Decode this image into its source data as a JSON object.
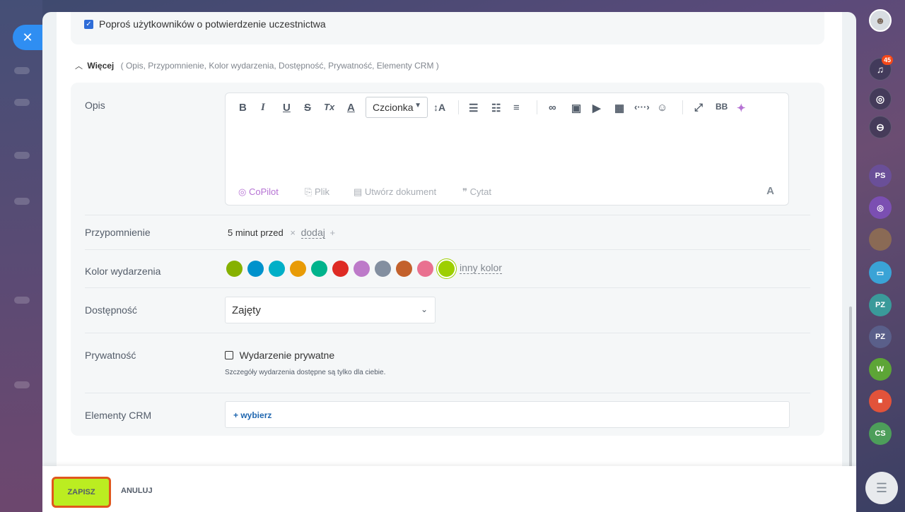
{
  "top": {
    "confirm_label": "Poproś użytkowników o potwierdzenie uczestnictwa"
  },
  "more": {
    "title": "Więcej",
    "items": "( Opis,  Przypomnienie,  Kolor wydarzenia,  Dostępność,  Prywatność,  Elementy CRM )"
  },
  "description": {
    "label": "Opis",
    "toolbar": {
      "bold": "B",
      "italic": "I",
      "underline": "U",
      "strike": "S",
      "clear": "Tx",
      "font_color": "A",
      "font_select": "Czcionka",
      "font_size": "↕A",
      "bb_code": "BB"
    },
    "footer": {
      "copilot": "CoPilot",
      "file": "Plik",
      "create_doc": "Utwórz dokument",
      "quote": "Cytat",
      "format": "A"
    }
  },
  "reminder": {
    "label": "Przypomnienie",
    "value": "5 minut przed",
    "remove": "×",
    "add": "dodaj",
    "add_plus": "+"
  },
  "color": {
    "label": "Kolor wydarzenia",
    "swatches": [
      "#86b100",
      "#0092cc",
      "#00afc7",
      "#e89b06",
      "#00b38c",
      "#de2b24",
      "#bd7ac9",
      "#838fa0",
      "#c3612c",
      "#e97090",
      "#9dcf00"
    ],
    "selected_index": 10,
    "other": "inny kolor"
  },
  "availability": {
    "label": "Dostępność",
    "value": "Zajęty"
  },
  "privacy": {
    "label": "Prywatność",
    "checkbox_label": "Wydarzenie prywatne",
    "hint": "Szczegóły wydarzenia dostępne są tylko dla ciebie."
  },
  "crm": {
    "label": "Elementy CRM",
    "select": "+  wybierz"
  },
  "footer": {
    "save": "ZAPISZ",
    "cancel": "ANULUJ"
  },
  "sidebar": {
    "notifications_count": "45",
    "chats": [
      "PS",
      "PZ",
      "PZ",
      "W",
      "CS"
    ]
  },
  "colors": {
    "accent": "#2f8ef2",
    "save_bg": "#bbed21",
    "save_border": "#e0571d"
  }
}
